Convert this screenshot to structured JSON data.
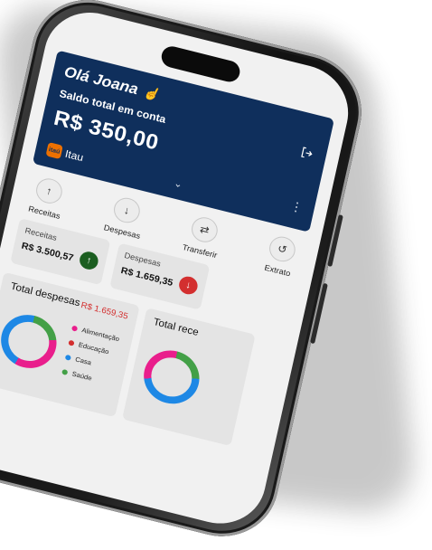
{
  "user": {
    "greeting": "Olá Joana",
    "greeting_icon": "waving-hand-icon"
  },
  "balance": {
    "label": "Saldo total em conta",
    "value": "R$ 350,00"
  },
  "bank": {
    "name": "Itau",
    "logo_text": "itaú",
    "logo_color": "#ec7000"
  },
  "theme": {
    "header_bg": "#0f2f5c",
    "screen_bg": "#f1f1f1",
    "card_bg": "#e4e4e4"
  },
  "actions": [
    {
      "label": "Receitas",
      "icon": "arrow-up-icon"
    },
    {
      "label": "Despesas",
      "icon": "arrow-down-icon"
    },
    {
      "label": "Transferir",
      "icon": "transfer-icon"
    },
    {
      "label": "Extrato",
      "icon": "history-icon"
    }
  ],
  "cards": {
    "receitas": {
      "title": "Receitas",
      "value": "R$ 3.500,57",
      "color": "#1b5e20"
    },
    "despesas": {
      "title": "Despesas",
      "value": "R$ 1.659,35",
      "color": "#d32f2f"
    }
  },
  "total_despesas": {
    "title": "Total despesas",
    "value": "R$ 1.659,35",
    "categories": [
      {
        "label": "Alimentação",
        "color": "#e91e8c"
      },
      {
        "label": "Educação",
        "color": "#d32f2f"
      },
      {
        "label": "Casa",
        "color": "#1e88e5"
      },
      {
        "label": "Saúde",
        "color": "#43a047"
      }
    ]
  },
  "total_receitas": {
    "title": "Total rece"
  }
}
